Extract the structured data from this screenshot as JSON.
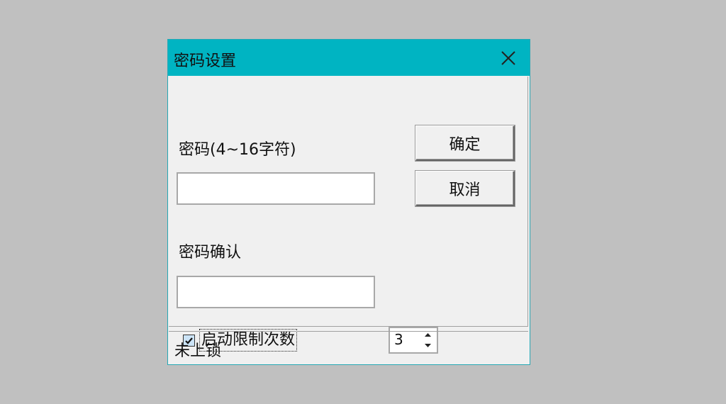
{
  "window": {
    "title": "密码设置",
    "close_icon": "close-icon"
  },
  "form": {
    "password_label": "密码(4~16字符)",
    "password_value": "",
    "confirm_label": "密码确认",
    "confirm_value": "",
    "limit_label": "启动限制次数",
    "limit_checked": true,
    "limit_count": "3"
  },
  "buttons": {
    "ok_label": "确定",
    "cancel_label": "取消"
  },
  "status": {
    "text": "未上锁"
  },
  "colors": {
    "titlebar": "#00b4c2",
    "background": "#c0c0c0",
    "window_bg": "#f0f0f0"
  }
}
